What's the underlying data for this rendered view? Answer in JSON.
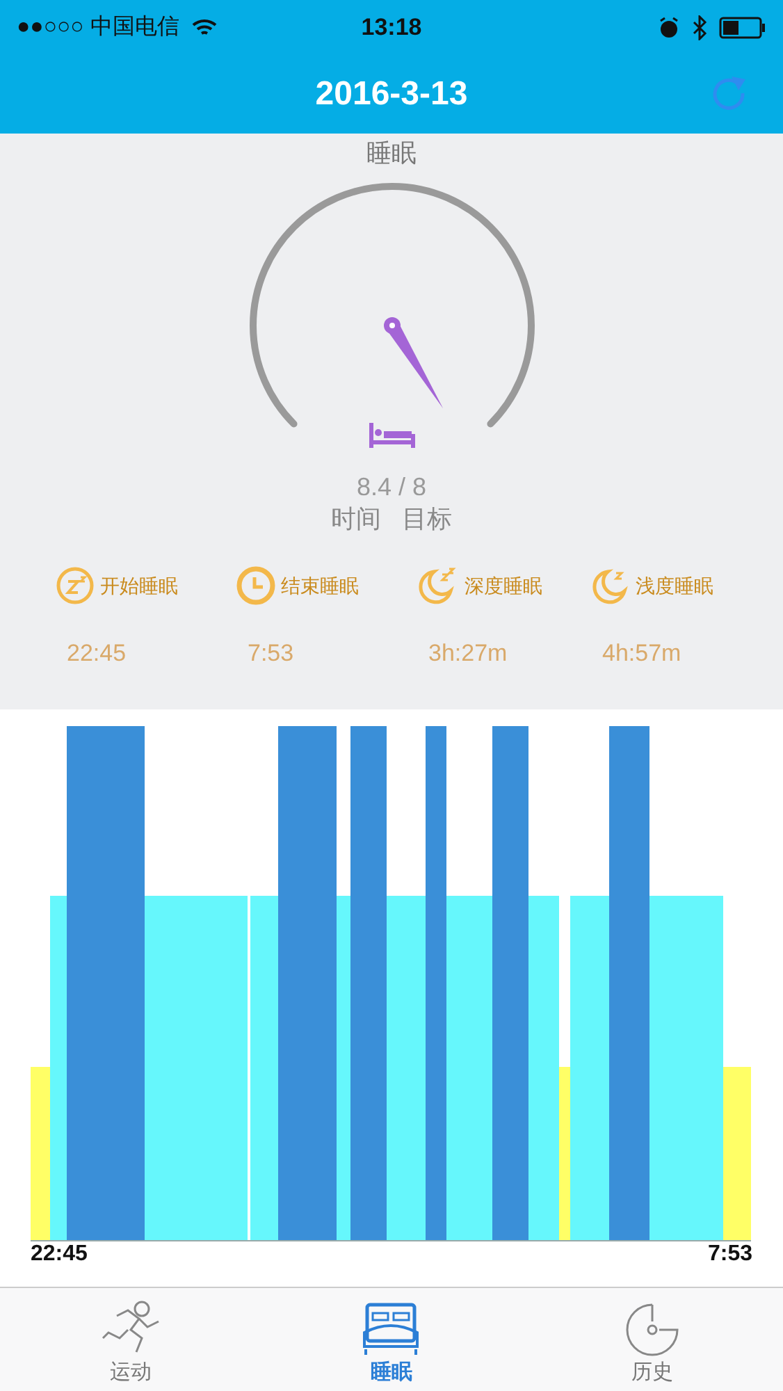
{
  "status_bar": {
    "carrier": "●●○○○ 中国电信",
    "time": "13:18"
  },
  "header": {
    "title": "2016-3-13"
  },
  "gauge": {
    "title": "睡眠",
    "reading": "8.4 / 8",
    "caption": "时间   目标"
  },
  "stats": [
    {
      "kind": "start",
      "label": "开始睡眠",
      "value": "22:45"
    },
    {
      "kind": "end",
      "label": "结束睡眠",
      "value": "7:53"
    },
    {
      "kind": "deep",
      "label": "深度睡眠",
      "value": "3h:27m"
    },
    {
      "kind": "light",
      "label": "浅度睡眠",
      "value": "4h:57m"
    }
  ],
  "chart": {
    "start_label": "22:45",
    "end_label": "7:53"
  },
  "tabs": [
    {
      "kind": "sport",
      "label": "运动",
      "selected": false
    },
    {
      "kind": "sleep",
      "label": "睡眠",
      "selected": true
    },
    {
      "kind": "history",
      "label": "历史",
      "selected": false
    }
  ]
}
